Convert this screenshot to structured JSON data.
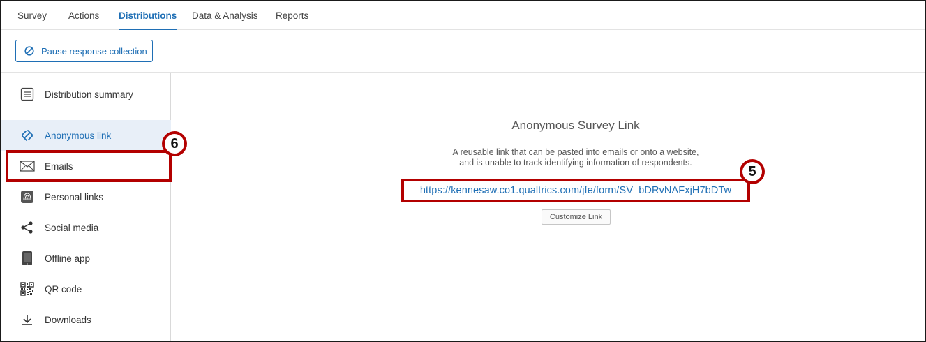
{
  "nav": {
    "tabs": [
      {
        "label": "Survey"
      },
      {
        "label": "Actions"
      },
      {
        "label": "Distributions",
        "active": true
      },
      {
        "label": "Data & Analysis"
      },
      {
        "label": "Reports"
      }
    ]
  },
  "toolbar": {
    "pause_label": "Pause response collection",
    "pause_icon": "block-icon"
  },
  "sidebar": {
    "summary": {
      "label": "Distribution summary",
      "icon": "document-icon"
    },
    "items": [
      {
        "label": "Anonymous link",
        "icon": "link-icon",
        "active": true
      },
      {
        "label": "Emails",
        "icon": "envelope-icon"
      },
      {
        "label": "Personal links",
        "icon": "fingerprint-icon"
      },
      {
        "label": "Social media",
        "icon": "share-icon"
      },
      {
        "label": "Offline app",
        "icon": "phone-icon"
      },
      {
        "label": "QR code",
        "icon": "qr-code-icon"
      },
      {
        "label": "Downloads",
        "icon": "download-icon"
      }
    ]
  },
  "main": {
    "title": "Anonymous Survey Link",
    "description_line1": "A reusable link that can be pasted into emails or onto a website,",
    "description_line2": "and is unable to track identifying information of respondents.",
    "link": "https://kennesaw.co1.qualtrics.com/jfe/form/SV_bDRvNAFxjH7bDTw",
    "customize_label": "Customize Link"
  },
  "annotations": {
    "badge_emails": "6",
    "badge_link": "5"
  },
  "colors": {
    "accent": "#1f6fb5",
    "annotation": "#b30000",
    "active_bg": "#e8eff8"
  }
}
